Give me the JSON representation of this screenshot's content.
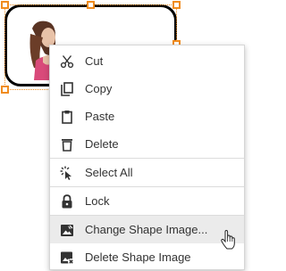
{
  "canvas": {
    "shape_image": "woman-photo",
    "selection_color": "#f08c1f"
  },
  "context_menu": {
    "items": [
      {
        "label": "Cut",
        "icon": "scissors-icon"
      },
      {
        "label": "Copy",
        "icon": "copy-icon"
      },
      {
        "label": "Paste",
        "icon": "clipboard-icon"
      },
      {
        "label": "Delete",
        "icon": "trash-icon"
      },
      {
        "label": "Select All",
        "icon": "select-all-cursor-icon"
      },
      {
        "label": "Lock",
        "icon": "lock-icon"
      },
      {
        "label": "Change Shape Image...",
        "icon": "change-image-icon",
        "highlighted": true
      },
      {
        "label": "Delete Shape Image",
        "icon": "delete-image-icon"
      }
    ]
  },
  "pointer": "hand-pointer-icon"
}
